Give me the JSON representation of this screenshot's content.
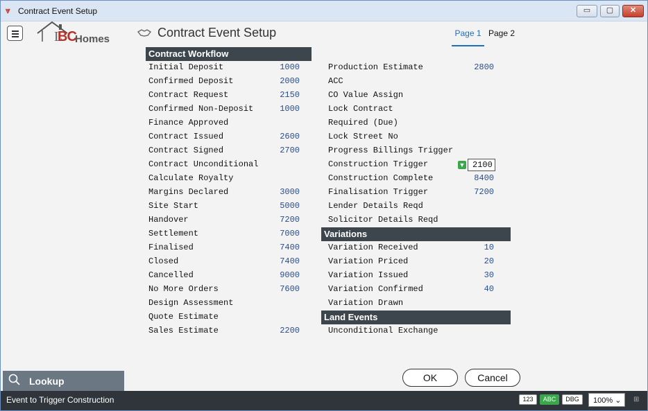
{
  "window": {
    "title": "Contract Event Setup",
    "buttons": {
      "minimize": "▭",
      "maximize": "▢",
      "close": "✕"
    }
  },
  "header": {
    "logo": {
      "l": "L",
      "bc": "BC",
      "homes": "Homes"
    },
    "title": "Contract Event Setup",
    "tabs": [
      {
        "label": "Page 1",
        "active": true
      },
      {
        "label": "Page 2",
        "active": false
      }
    ]
  },
  "contract_workflow": {
    "heading": "Contract Workflow",
    "rows": [
      {
        "label": "Initial Deposit",
        "value": "1000"
      },
      {
        "label": "Confirmed Deposit",
        "value": "2000"
      },
      {
        "label": "Contract Request",
        "value": "2150"
      },
      {
        "label": "Confirmed Non-Deposit",
        "value": "1000"
      },
      {
        "label": "Finance Approved",
        "value": ""
      },
      {
        "label": "Contract Issued",
        "value": "2600"
      },
      {
        "label": "Contract Signed",
        "value": "2700"
      },
      {
        "label": "Contract Unconditional",
        "value": ""
      },
      {
        "label": "Calculate Royalty",
        "value": ""
      },
      {
        "label": "Margins Declared",
        "value": "3000"
      },
      {
        "label": "Site Start",
        "value": "5000"
      },
      {
        "label": "Handover",
        "value": "7200"
      },
      {
        "label": "Settlement",
        "value": "7000"
      },
      {
        "label": "Finalised",
        "value": "7400"
      },
      {
        "label": "Closed",
        "value": "7400"
      },
      {
        "label": "Cancelled",
        "value": "9000"
      },
      {
        "label": "No More Orders",
        "value": "7600"
      },
      {
        "label": "Design Assessment",
        "value": ""
      },
      {
        "label": "Quote Estimate",
        "value": ""
      },
      {
        "label": "Sales Estimate",
        "value": "2200"
      }
    ]
  },
  "right_column": {
    "rows": [
      {
        "label": "Production Estimate",
        "value": "2800"
      },
      {
        "label": "ACC",
        "value": ""
      },
      {
        "label": "CO Value Assign",
        "value": ""
      },
      {
        "label": "Lock Contract",
        "value": ""
      },
      {
        "label": "Required (Due)",
        "value": ""
      },
      {
        "label": "Lock Street No",
        "value": ""
      },
      {
        "label": "Progress Billings Trigger",
        "value": ""
      },
      {
        "label": "Construction Trigger",
        "value": "2100"
      },
      {
        "label": "Construction Complete",
        "value": "8400"
      },
      {
        "label": "Finalisation Trigger",
        "value": "7200"
      },
      {
        "label": "Lender Details Reqd",
        "value": ""
      },
      {
        "label": "Solicitor Details Reqd",
        "value": ""
      }
    ]
  },
  "variations": {
    "heading": "Variations",
    "rows": [
      {
        "label": "Variation Received",
        "value": "10"
      },
      {
        "label": "Variation Priced",
        "value": "20"
      },
      {
        "label": "Variation Issued",
        "value": "30"
      },
      {
        "label": "Variation Confirmed",
        "value": "40"
      },
      {
        "label": "Variation Drawn",
        "value": ""
      }
    ]
  },
  "land_events": {
    "heading": "Land Events",
    "rows": [
      {
        "label": "Unconditional Exchange",
        "value": ""
      }
    ]
  },
  "lookup": {
    "label": "Lookup"
  },
  "buttons": {
    "ok": "OK",
    "cancel": "Cancel"
  },
  "status": {
    "text": "Event to Trigger Construction",
    "badges": {
      "num": "123",
      "abc": "ABC",
      "dbg": "DBG"
    },
    "zoom": "100%"
  },
  "colors": {
    "section_header": "#3d464d",
    "value_text": "#2a4c8a",
    "active_tab": "#1f6fbf",
    "abc_badge": "#3aa84a"
  }
}
